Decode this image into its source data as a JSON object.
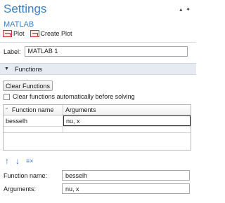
{
  "header": {
    "title": "Settings",
    "subtitle": "MATLAB"
  },
  "window_icons": {
    "pin": "pin-icon",
    "close": "close-icon"
  },
  "toolbar": {
    "plot_label": "Plot",
    "create_plot_label": "Create Plot"
  },
  "label_field": {
    "label": "Label:",
    "value": "MATLAB 1"
  },
  "section": {
    "title": "Functions",
    "expanded": true
  },
  "clear_functions_button": "Clear Functions",
  "clear_before_solving": {
    "label": "Clear functions automatically before solving",
    "checked": false
  },
  "table": {
    "columns": [
      "Function name",
      "Arguments"
    ],
    "rows": [
      {
        "function_name": "besselh",
        "arguments": "nu, x"
      }
    ]
  },
  "form": {
    "function_name_label": "Function name:",
    "function_name_value": "besselh",
    "arguments_label": "Arguments:",
    "arguments_value": "nu, x"
  },
  "colors": {
    "title": "#3c7fc4",
    "section_bg": "#e6ebf2",
    "arrow": "#2c6fbf"
  }
}
